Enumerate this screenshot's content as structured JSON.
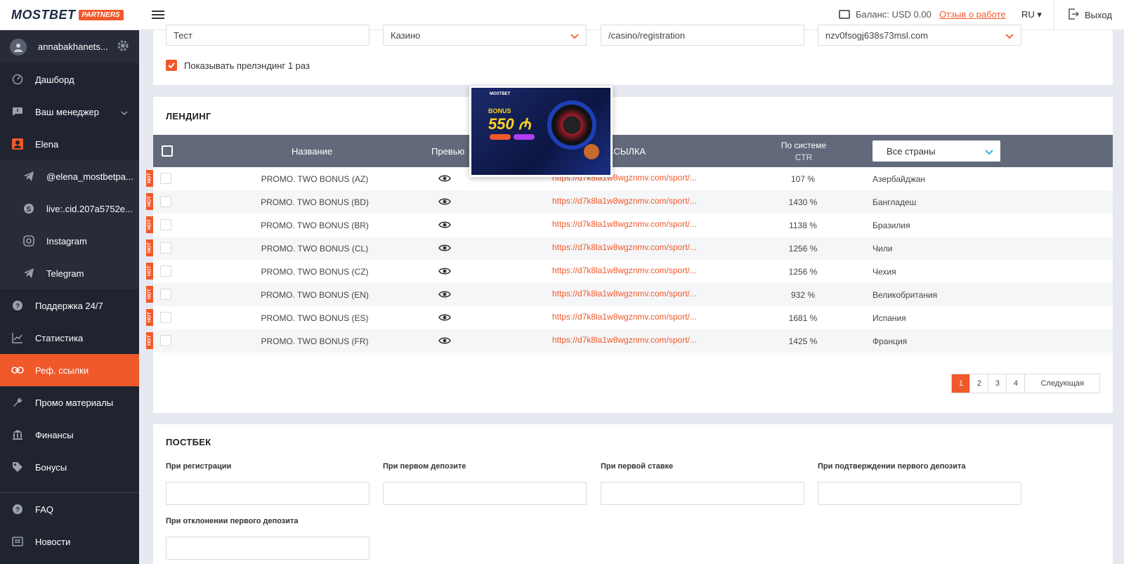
{
  "brand": {
    "name": "MOSTBET",
    "badge": "PARTNERS"
  },
  "user": {
    "name": "annabakhanets..."
  },
  "sidebar": {
    "items": [
      {
        "label": "Дашборд",
        "icon": "dashboard-icon"
      },
      {
        "label": "Ваш менеджер",
        "icon": "chat-icon"
      },
      {
        "label": "Elena",
        "icon": "person-icon"
      },
      {
        "label": "@elena_mostbetpa...",
        "icon": "telegram-icon"
      },
      {
        "label": "live:.cid.207a5752e...",
        "icon": "skype-icon"
      },
      {
        "label": "Instagram",
        "icon": "instagram-icon"
      },
      {
        "label": "Telegram",
        "icon": "telegram-icon"
      },
      {
        "label": "Поддержка 24/7",
        "icon": "help-icon"
      },
      {
        "label": "Статистика",
        "icon": "chart-icon"
      },
      {
        "label": "Реф. ссылки",
        "icon": "link-icon"
      },
      {
        "label": "Промо материалы",
        "icon": "wrench-icon"
      },
      {
        "label": "Финансы",
        "icon": "bank-icon"
      },
      {
        "label": "Бонусы",
        "icon": "tag-icon"
      },
      {
        "label": "FAQ",
        "icon": "help-icon"
      },
      {
        "label": "Новости",
        "icon": "news-icon"
      }
    ]
  },
  "topbar": {
    "balance": "Баланс: USD 0.00",
    "feedback": "Отзыв о работе",
    "lang": "RU ▾",
    "logout": "Выход"
  },
  "form": {
    "name_value": "Тест",
    "type_value": "Казино",
    "path_value": "/casino/registration",
    "domain_value": "nzv0fsogj638s73msl.com",
    "checkbox_label": "Показывать прелэндинг 1 раз"
  },
  "landing": {
    "title": "ЛЕНДИНГ",
    "headers": {
      "name": "Название",
      "preview": "Превью",
      "link": "ССЫЛКА",
      "ctr_top": "По системе",
      "ctr_bottom": "CTR",
      "countries": "Все страны"
    },
    "hot_label": "HOT",
    "preview_card": {
      "logo": "MOSTBET",
      "bonus": "BONUS",
      "amount": "550 ₼"
    },
    "rows": [
      {
        "name": "PROMO. TWO BONUS (AZ)",
        "link": "https://d7k8la1w8wgznmv.com/sport/...",
        "ctr": "107 %",
        "country": "Азербайджан"
      },
      {
        "name": "PROMO. TWO BONUS (BD)",
        "link": "https://d7k8la1w8wgznmv.com/sport/...",
        "ctr": "1430 %",
        "country": "Бангладеш"
      },
      {
        "name": "PROMO. TWO BONUS (BR)",
        "link": "https://d7k8la1w8wgznmv.com/sport/...",
        "ctr": "1138 %",
        "country": "Бразилия"
      },
      {
        "name": "PROMO. TWO BONUS (CL)",
        "link": "https://d7k8la1w8wgznmv.com/sport/...",
        "ctr": "1256 %",
        "country": "Чили"
      },
      {
        "name": "PROMO. TWO BONUS (CZ)",
        "link": "https://d7k8la1w8wgznmv.com/sport/...",
        "ctr": "1256 %",
        "country": "Чехия"
      },
      {
        "name": "PROMO. TWO BONUS (EN)",
        "link": "https://d7k8la1w8wgznmv.com/sport/...",
        "ctr": "932 %",
        "country": "Великобритания"
      },
      {
        "name": "PROMO. TWO BONUS (ES)",
        "link": "https://d7k8la1w8wgznmv.com/sport/...",
        "ctr": "1681 %",
        "country": "Испания"
      },
      {
        "name": "PROMO. TWO BONUS (FR)",
        "link": "https://d7k8la1w8wgznmv.com/sport/...",
        "ctr": "1425 %",
        "country": "Франция"
      }
    ],
    "pagination": {
      "pages": [
        "1",
        "2",
        "3",
        "4"
      ],
      "next": "Следующая"
    }
  },
  "postback": {
    "title": "ПОСТБЕК",
    "labels": {
      "registration": "При регистрации",
      "first_deposit": "При первом депозите",
      "first_bet": "При первой ставке",
      "deposit_confirm": "При подтверждении первого депозита",
      "deposit_reject": "При отклонении первого депозита"
    }
  },
  "colors": {
    "accent": "#f0592a",
    "sidebar": "#1f2430",
    "table_header": "#62697a"
  }
}
